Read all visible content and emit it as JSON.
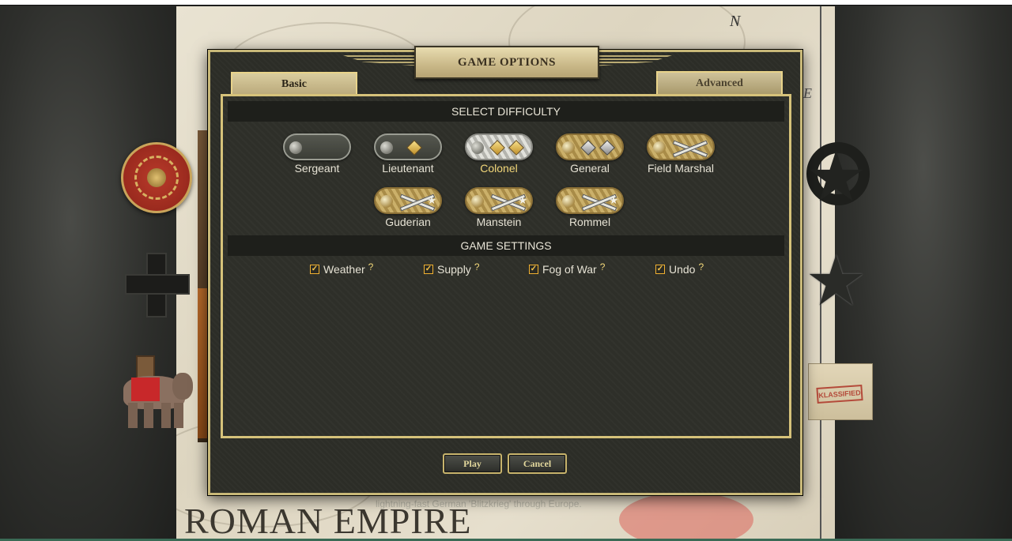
{
  "dialog": {
    "title": "GAME OPTIONS",
    "tabs": {
      "basic": "Basic",
      "advanced": "Advanced"
    }
  },
  "difficulty": {
    "header": "SELECT DIFFICULTY",
    "selected": "Colonel",
    "ranks": [
      {
        "label": "Sergeant",
        "insignia": "plain-grey-strap"
      },
      {
        "label": "Lieutenant",
        "insignia": "grey-strap-one-gold-pip"
      },
      {
        "label": "Colonel",
        "insignia": "silver-braid-two-gold-pips"
      },
      {
        "label": "General",
        "insignia": "gold-braid-two-silver-pips"
      },
      {
        "label": "Field Marshal",
        "insignia": "gold-braid-crossed-batons"
      },
      {
        "label": "Guderian",
        "insignia": "gold-braid-crossed-batons-star"
      },
      {
        "label": "Manstein",
        "insignia": "gold-braid-crossed-batons-star"
      },
      {
        "label": "Rommel",
        "insignia": "gold-braid-crossed-batons-star"
      }
    ]
  },
  "settings": {
    "header": "GAME SETTINGS",
    "options": [
      {
        "label": "Weather",
        "checked": true,
        "help": "?"
      },
      {
        "label": "Supply",
        "checked": true,
        "help": "?"
      },
      {
        "label": "Fog of War",
        "checked": true,
        "help": "?"
      },
      {
        "label": "Undo",
        "checked": true,
        "help": "?"
      }
    ]
  },
  "buttons": {
    "play": "Play",
    "cancel": "Cancel"
  },
  "background": {
    "map_title": "ROMAN EMPIRE",
    "compass_letter": "N",
    "map_letter": "E",
    "caption": "lightning-fast German 'Blitzkrieg' through Europe.",
    "folder_stamp": "KLASSIFIED"
  },
  "colors": {
    "accent_gold": "#d6c27a",
    "selected_label": "#f2d779",
    "panel_bg": "#2e2f29",
    "checkbox_accent": "#f0b030"
  }
}
